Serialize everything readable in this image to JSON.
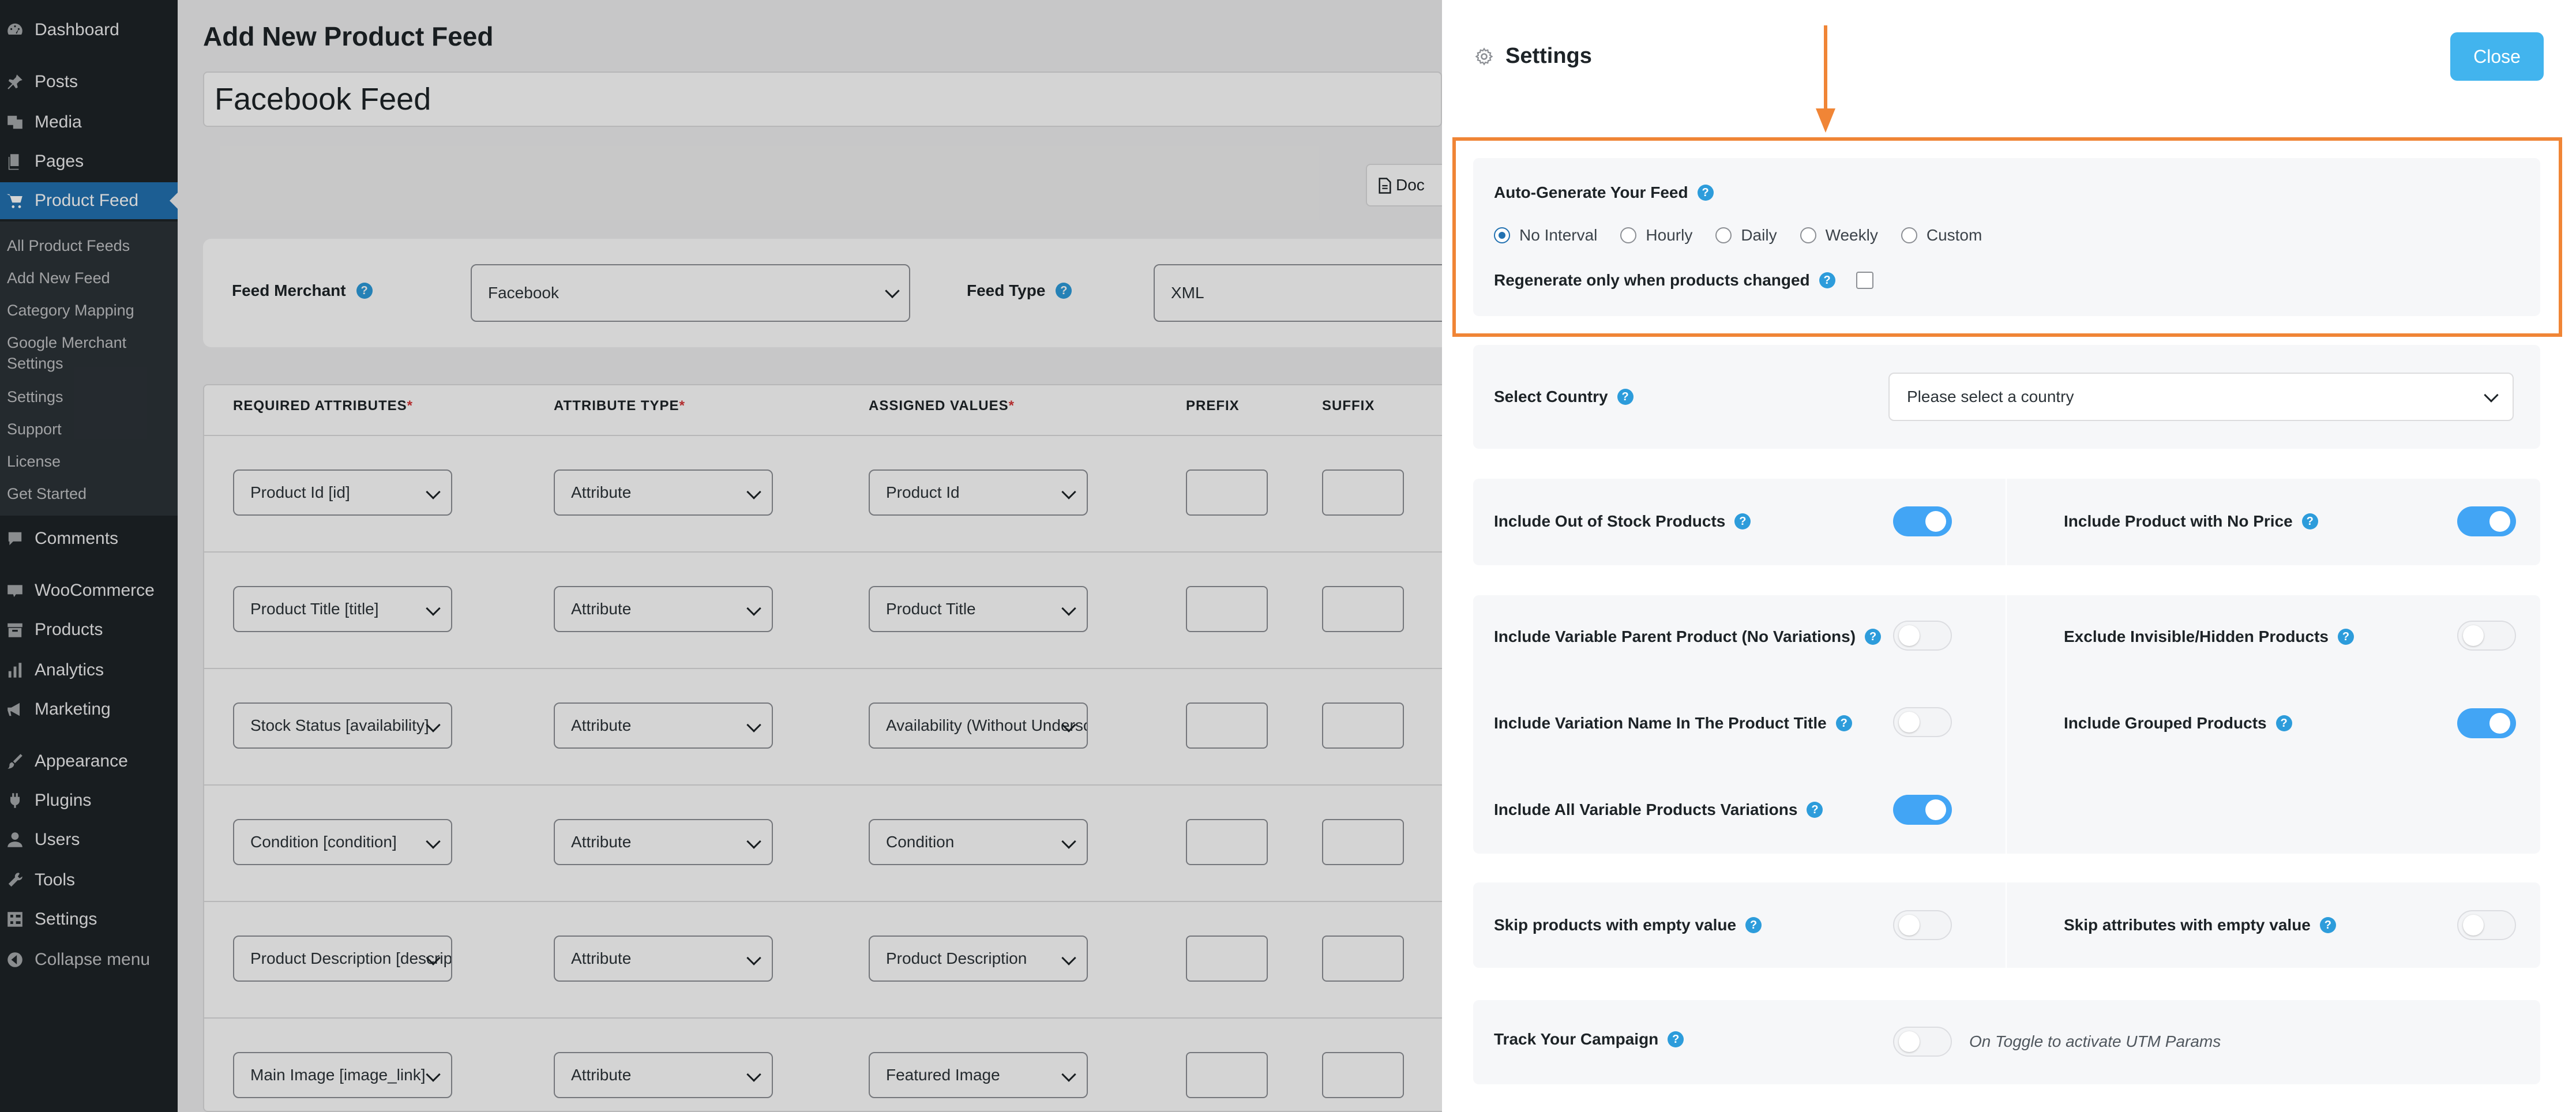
{
  "sidebar": {
    "items": [
      {
        "label": "Dashboard",
        "icon": "dashboard-icon"
      },
      {
        "label": "Posts",
        "icon": "pin-icon"
      },
      {
        "label": "Media",
        "icon": "media-icon"
      },
      {
        "label": "Pages",
        "icon": "pages-icon"
      },
      {
        "label": "Product Feed",
        "icon": "cart-icon",
        "active": true
      },
      {
        "label": "Comments",
        "icon": "comment-icon"
      },
      {
        "label": "WooCommerce",
        "icon": "woo-icon"
      },
      {
        "label": "Products",
        "icon": "archive-icon"
      },
      {
        "label": "Analytics",
        "icon": "bar-chart-icon"
      },
      {
        "label": "Marketing",
        "icon": "megaphone-icon"
      },
      {
        "label": "Appearance",
        "icon": "brush-icon"
      },
      {
        "label": "Plugins",
        "icon": "plug-icon"
      },
      {
        "label": "Users",
        "icon": "user-icon"
      },
      {
        "label": "Tools",
        "icon": "wrench-icon"
      },
      {
        "label": "Settings",
        "icon": "settings-grid-icon"
      },
      {
        "label": "Collapse menu",
        "icon": "collapse-icon"
      }
    ],
    "submenu": [
      "All Product Feeds",
      "Add New Feed",
      "Category Mapping",
      "Google Merchant Settings",
      "Settings",
      "Support",
      "License",
      "Get Started"
    ]
  },
  "main": {
    "page_title": "Add New Product Feed",
    "feed_name": "Facebook Feed",
    "doc_button": "Doc",
    "feed_merchant_label": "Feed Merchant",
    "feed_merchant_value": "Facebook",
    "feed_type_label": "Feed Type",
    "feed_type_value": "XML",
    "table": {
      "headers": [
        "REQUIRED ATTRIBUTES",
        "ATTRIBUTE TYPE",
        "ASSIGNED VALUES",
        "PREFIX",
        "SUFFIX"
      ],
      "required_marker": "*",
      "rows": [
        {
          "attribute": "Product Id [id]",
          "type": "Attribute",
          "value": "Product Id"
        },
        {
          "attribute": "Product Title [title]",
          "type": "Attribute",
          "value": "Product Title"
        },
        {
          "attribute": "Stock Status [availability]",
          "type": "Attribute",
          "value": "Availability (Without Underscore)"
        },
        {
          "attribute": "Condition [condition]",
          "type": "Attribute",
          "value": "Condition"
        },
        {
          "attribute": "Product Description [description]",
          "type": "Attribute",
          "value": "Product Description"
        },
        {
          "attribute": "Main Image [image_link]",
          "type": "Attribute",
          "value": "Featured Image"
        }
      ]
    }
  },
  "drawer": {
    "title": "Settings",
    "close_label": "Close",
    "auto_generate": {
      "label": "Auto-Generate Your Feed",
      "options": [
        "No Interval",
        "Hourly",
        "Daily",
        "Weekly",
        "Custom"
      ],
      "selected": "No Interval",
      "regenerate_label": "Regenerate only when products changed"
    },
    "country": {
      "label": "Select Country",
      "placeholder": "Please select a country"
    },
    "toggles": {
      "out_of_stock": {
        "label": "Include Out of Stock Products",
        "on": true
      },
      "no_price": {
        "label": "Include Product with No Price",
        "on": true
      },
      "variable_parent": {
        "label": "Include Variable Parent Product (No Variations)",
        "on": false
      },
      "invisible_hidden": {
        "label": "Exclude Invisible/Hidden Products",
        "on": false
      },
      "variation_name": {
        "label": "Include Variation Name In The Product Title",
        "on": false
      },
      "grouped": {
        "label": "Include Grouped Products",
        "on": true
      },
      "all_variations": {
        "label": "Include All Variable Products Variations",
        "on": true
      },
      "skip_empty_value": {
        "label": "Skip products with empty value",
        "on": false
      },
      "skip_empty_attr": {
        "label": "Skip attributes with empty value",
        "on": false
      },
      "track_campaign": {
        "label": "Track Your Campaign",
        "on": false
      }
    },
    "utm_note": "On Toggle to activate UTM Params"
  },
  "colors": {
    "wp_sidebar": "#1d2327",
    "wp_active": "#2271b1",
    "accent_blue": "#42b4ee",
    "toggle_on": "#42a5f5",
    "highlight_orange": "#f08536"
  }
}
